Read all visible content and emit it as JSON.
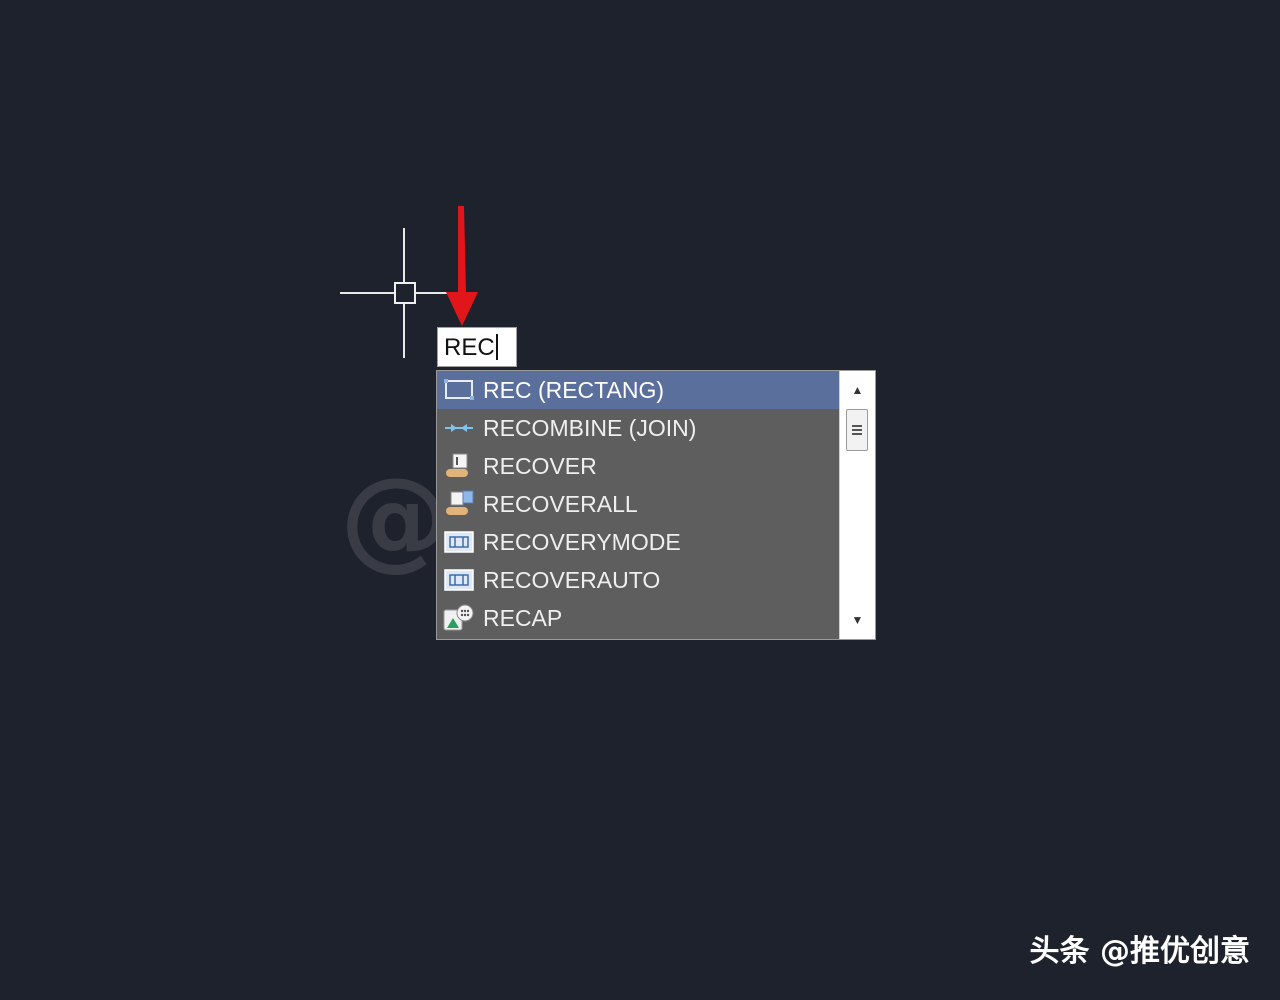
{
  "command_input": {
    "value": "REC"
  },
  "autocomplete": {
    "selected_index": 0,
    "items": [
      {
        "label": "REC (RECTANG)",
        "icon": "rectangle-icon"
      },
      {
        "label": "RECOMBINE (JOIN)",
        "icon": "join-icon"
      },
      {
        "label": "RECOVER",
        "icon": "recover-icon"
      },
      {
        "label": "RECOVERALL",
        "icon": "recoverall-icon"
      },
      {
        "label": "RECOVERYMODE",
        "icon": "recoverymode-icon"
      },
      {
        "label": "RECOVERAUTO",
        "icon": "recoverauto-icon"
      },
      {
        "label": "RECAP",
        "icon": "recap-icon"
      }
    ]
  },
  "watermark": {
    "text": "@推优创意"
  },
  "footer": {
    "text": "头条 @推优创意"
  },
  "colors": {
    "canvas_bg": "#1e222c",
    "selected_row": "#5b6f9c",
    "list_bg": "#5e5e5e",
    "annotation_arrow": "#e0161b"
  }
}
